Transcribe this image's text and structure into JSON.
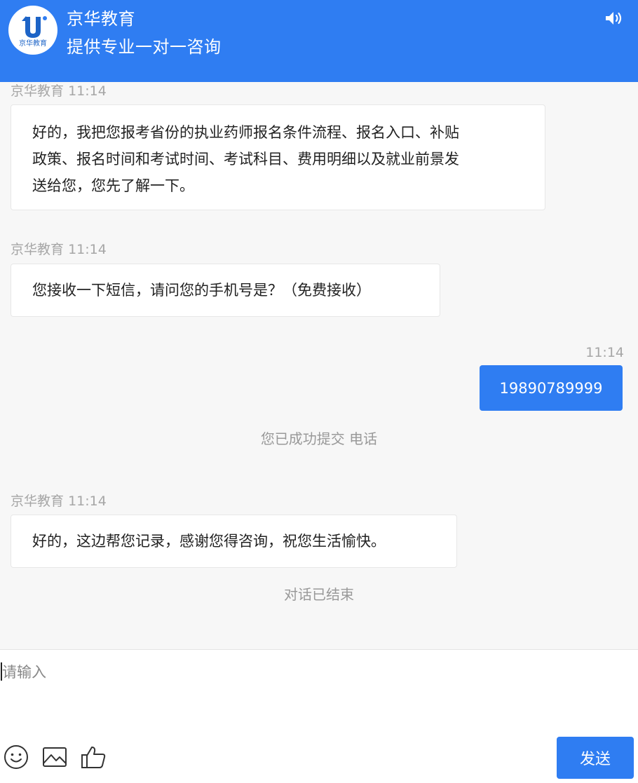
{
  "header": {
    "title": "京华教育",
    "subtitle": "提供专业一对一咨询",
    "logo_text": "京华教育",
    "logo_icon": "logo-u-icon",
    "sound_icon": "speaker-icon"
  },
  "messages": [
    {
      "sender": "京华教育",
      "time": "11:14",
      "lines": [
        "好的，我把您报考省份的执业药师报名条件流程、报名入口、补贴",
        "政策、报名时间和考试时间、考试科目、费用明细以及就业前景发",
        "送给您，您先了解一下。"
      ]
    },
    {
      "sender": "京华教育",
      "time": "11:14",
      "lines": [
        "您接收一下短信，请问您的手机号是？（免费接收）"
      ]
    },
    {
      "time": "11:14",
      "text": "19890789999"
    },
    {
      "sender": "京华教育",
      "time": "11:14",
      "lines": [
        "好的，这边帮您记录，感谢您得咨询，祝您生活愉快。"
      ]
    }
  ],
  "system": {
    "submitted": "您已成功提交 电话",
    "ended": "对话已结束"
  },
  "composer": {
    "placeholder": "请输入",
    "send_label": "发送",
    "tools": [
      "emoji-icon",
      "image-icon",
      "thumbs-up-icon"
    ]
  },
  "colors": {
    "accent": "#2f7df2",
    "background": "#f7f7f7",
    "meta_text": "#a6a6a6"
  }
}
